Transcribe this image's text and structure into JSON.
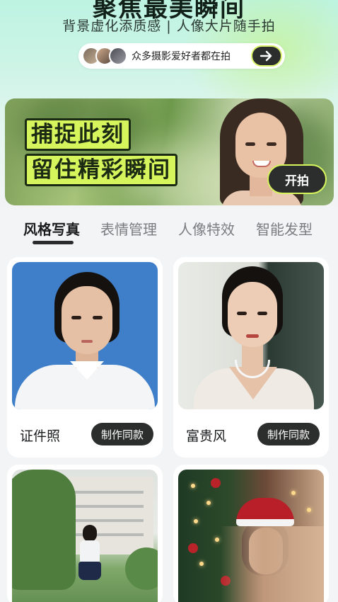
{
  "header": {
    "title": "聚焦最美瞬间",
    "subtitle": "背景虚化添质感 | 人像大片随手拍",
    "social_text": "众多摄影爱好者都在拍"
  },
  "banner": {
    "line1": "捕捉此刻",
    "line2": "留住精彩瞬间",
    "start_label": "开拍"
  },
  "tabs": [
    {
      "label": "风格写真",
      "active": true
    },
    {
      "label": "表情管理",
      "active": false
    },
    {
      "label": "人像特效",
      "active": false
    },
    {
      "label": "智能发型",
      "active": false
    }
  ],
  "cards": [
    {
      "label": "证件照",
      "button": "制作同款"
    },
    {
      "label": "富贵风",
      "button": "制作同款"
    }
  ],
  "colors": {
    "accent": "#d6f45c",
    "dark_button": "#2c2e2d"
  }
}
